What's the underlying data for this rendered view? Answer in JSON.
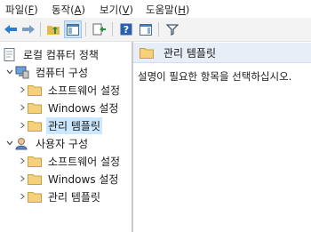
{
  "menu": [
    {
      "label": "파일(",
      "key": "F",
      "tail": ")"
    },
    {
      "label": "동작(",
      "key": "A",
      "tail": ")"
    },
    {
      "label": "보기(",
      "key": "V",
      "tail": ")"
    },
    {
      "label": "도움말(",
      "key": "H",
      "tail": ")"
    }
  ],
  "toolbar": {
    "icons": [
      "back-arrow-icon",
      "forward-arrow-icon",
      "up-folder-icon",
      "show-hide-console-tree-icon",
      "export-list-icon",
      "help-icon",
      "show-hide-action-pane-icon",
      "filter-icon"
    ]
  },
  "tree": {
    "root": "로컬 컴퓨터 정책",
    "computer_config": {
      "label": "컴퓨터 구성",
      "children": [
        "소프트웨어 설정",
        "Windows 설정",
        "관리 템플릿"
      ]
    },
    "user_config": {
      "label": "사용자 구성",
      "children": [
        "소프트웨어 설정",
        "Windows 설정",
        "관리 템플릿"
      ]
    }
  },
  "detail": {
    "header": "관리 템플릿",
    "description": "설명이 필요한 항목을 선택하십시오."
  }
}
